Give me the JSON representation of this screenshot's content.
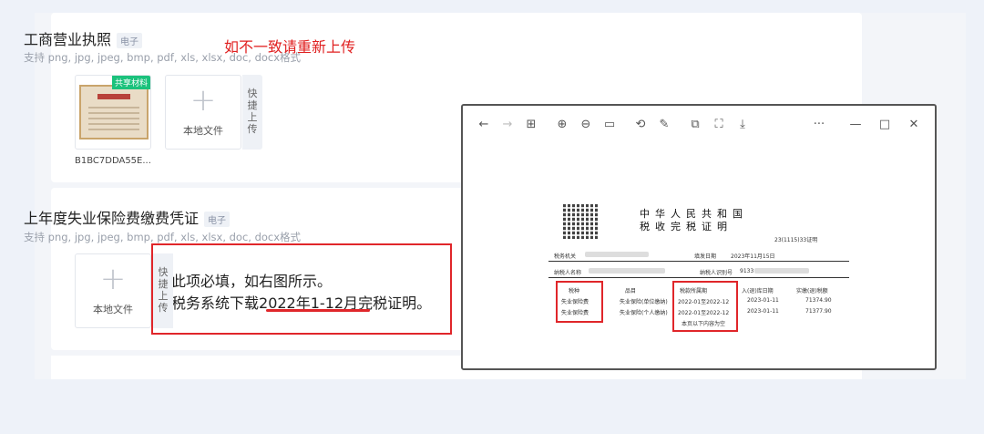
{
  "sections": [
    {
      "title": "工商营业执照",
      "tag": "电子",
      "hint": "支持 png, jpg, jpeg, bmp, pdf, xls, xlsx, doc, docx格式",
      "file_name": "B1BC7DDA55E...",
      "shared_badge": "共享材料",
      "upload_label": "本地文件",
      "quick_upload_label": "快捷上传"
    },
    {
      "title": "上年度失业保险费缴费凭证",
      "tag": "电子",
      "hint": "支持 png, jpg, jpeg, bmp, pdf, xls, xlsx, doc, docx格式",
      "upload_label": "本地文件",
      "quick_upload_label": "快捷上传"
    }
  ],
  "annotation": "如不一致请重新上传",
  "callout": {
    "line1": "此项必填，如右图所示。",
    "line2_prefix": "税务系统下载",
    "line2_highlight": "2022年1-12月",
    "line2_suffix": "完税证明。"
  },
  "viewer": {
    "toolbar_left": [
      "←",
      "→",
      "⊞",
      "⊕",
      "⊖",
      "▭",
      "⟲",
      "✎",
      "⧉",
      "⛶",
      "⤓"
    ],
    "toolbar_right": [
      "···",
      "—",
      "□",
      "✕"
    ],
    "cert": {
      "title_line1": "中华人民共和国",
      "title_line2": "税收完税证明",
      "number": "23(1115)33证明",
      "row1_left": "税务机关",
      "row1_right": "填发日期",
      "row1_date": "2023年11月15日",
      "row2_left": "纳税人名称",
      "row2_right": "纳税人识别号",
      "row2_id": "9133",
      "headers": [
        "税种",
        "品目",
        "税款所属期",
        "入(退)库日期",
        "实缴(退)税额"
      ],
      "rows": [
        [
          "失业保险费",
          "失业保险(单位缴纳)",
          "2022-01至2022-12",
          "2023-01-11",
          "71374.90"
        ],
        [
          "失业保险费",
          "失业保险(个人缴纳)",
          "2022-01至2022-12",
          "2023-01-11",
          "71377.90"
        ]
      ],
      "footer_note": "本页以下内容为空"
    }
  }
}
